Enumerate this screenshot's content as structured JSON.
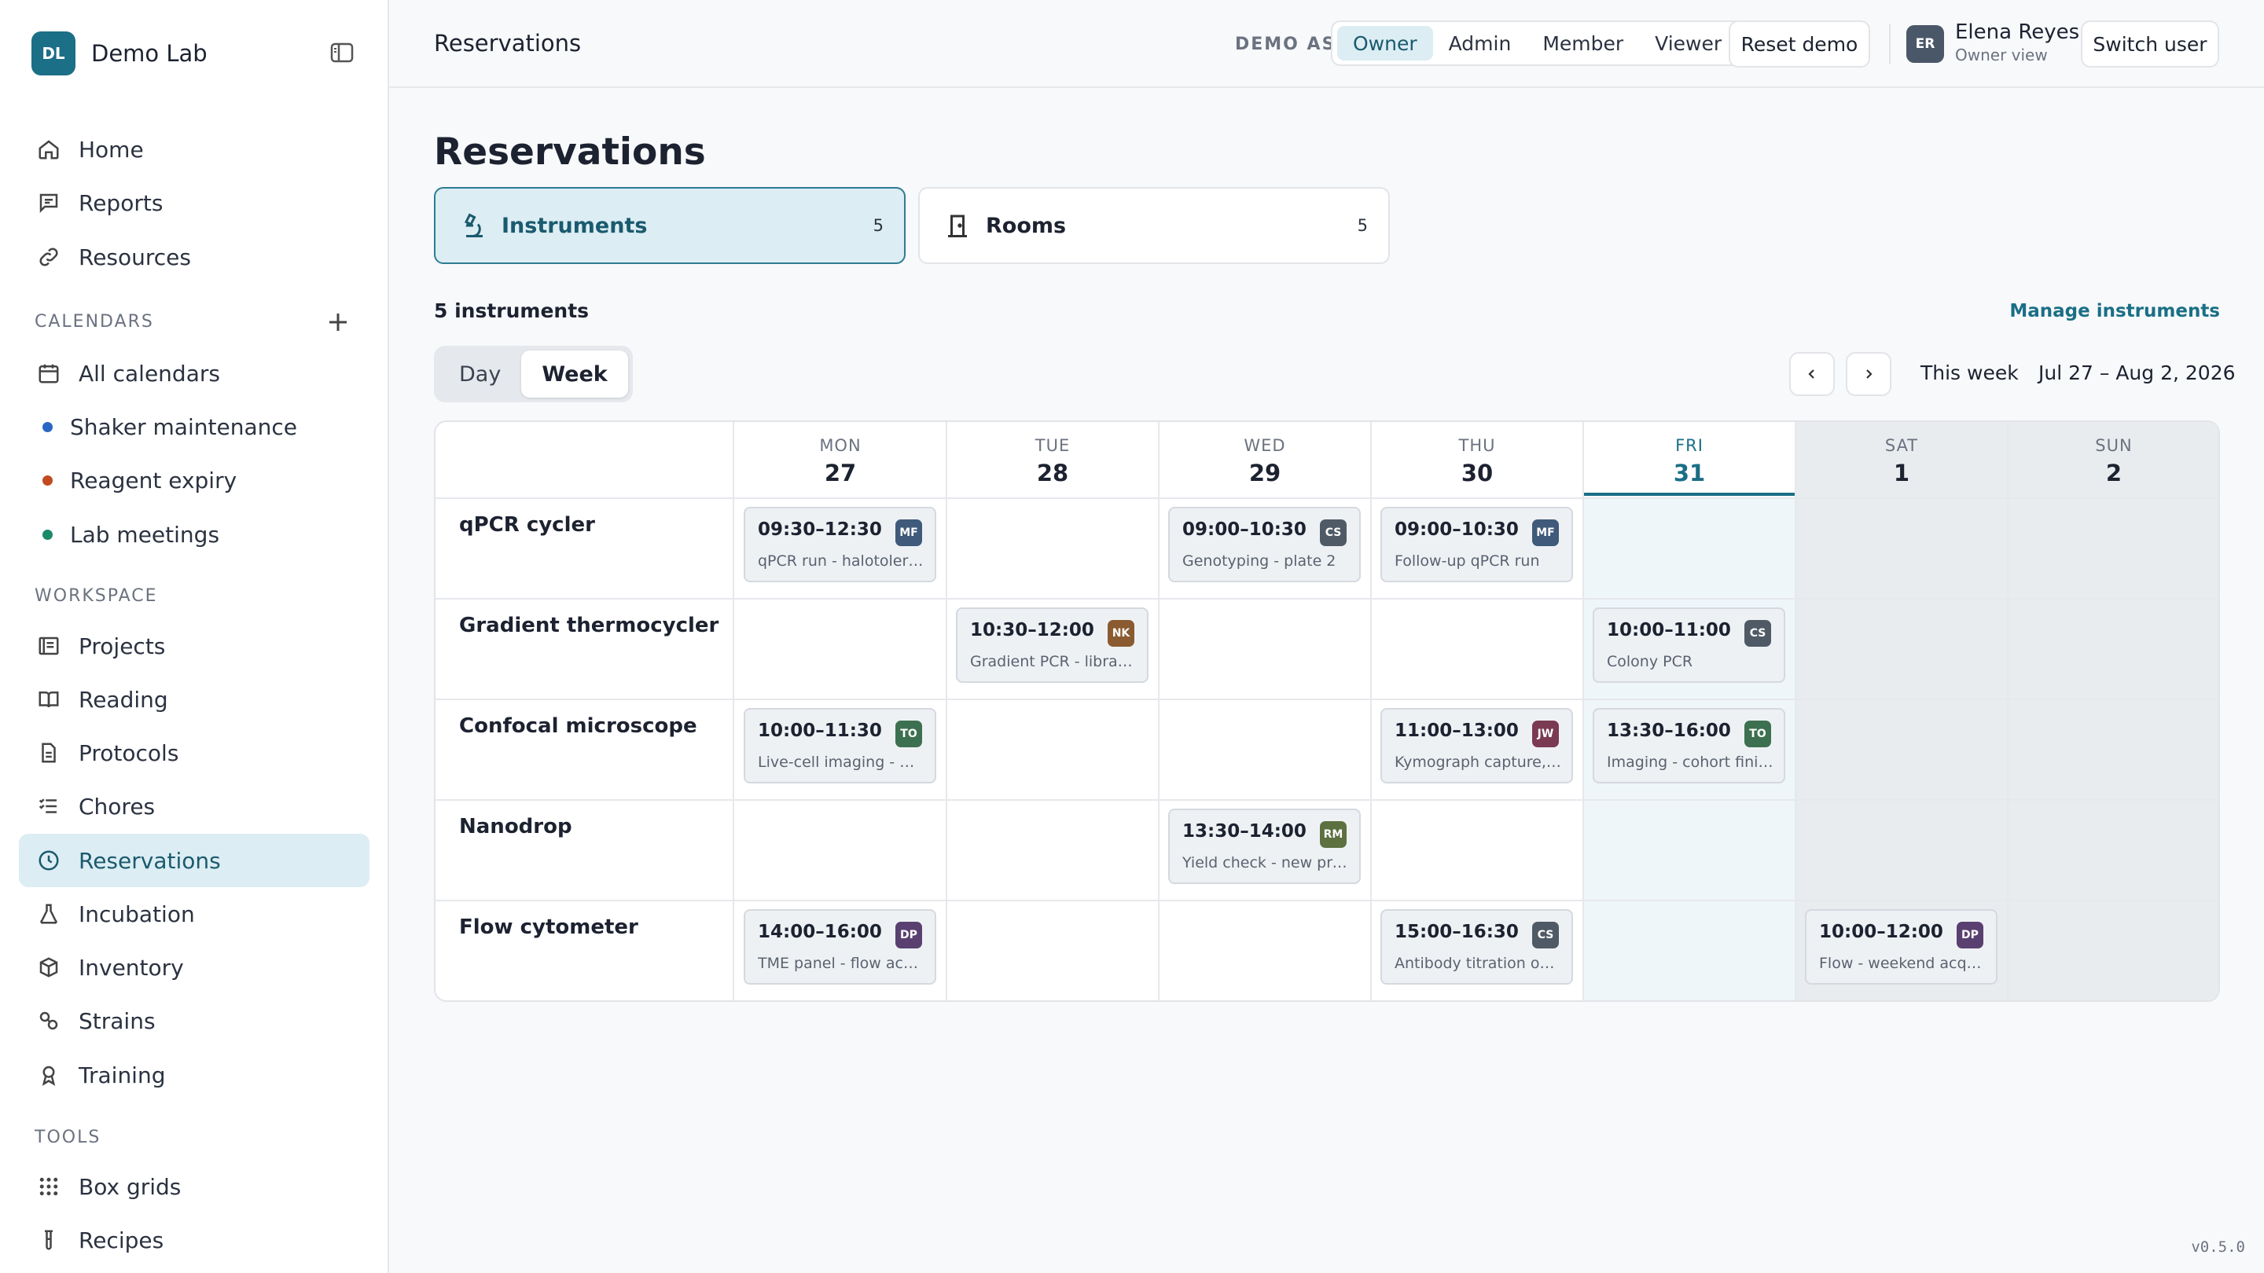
{
  "app": {
    "badge": "DL",
    "name": "Demo Lab"
  },
  "nav": {
    "top": [
      {
        "label": "Home",
        "icon": "home-icon"
      },
      {
        "label": "Reports",
        "icon": "message-square-icon"
      },
      {
        "label": "Resources",
        "icon": "link-icon"
      }
    ],
    "calendars_label": "CALENDARS",
    "calendars": [
      {
        "label": "All calendars",
        "icon": "calendar-icon"
      },
      {
        "label": "Shaker maintenance",
        "color": "#2a66c4"
      },
      {
        "label": "Reagent expiry",
        "color": "#c24a20"
      },
      {
        "label": "Lab meetings",
        "color": "#1a8a6a"
      }
    ],
    "workspace_label": "WORKSPACE",
    "workspace": [
      {
        "label": "Projects",
        "icon": "list-box-icon"
      },
      {
        "label": "Reading",
        "icon": "book-icon"
      },
      {
        "label": "Protocols",
        "icon": "document-icon"
      },
      {
        "label": "Chores",
        "icon": "checklist-icon"
      },
      {
        "label": "Reservations",
        "icon": "clock-icon",
        "active": true
      },
      {
        "label": "Incubation",
        "icon": "flask-icon"
      },
      {
        "label": "Inventory",
        "icon": "box-icon"
      },
      {
        "label": "Strains",
        "icon": "strains-icon"
      },
      {
        "label": "Training",
        "icon": "award-icon"
      }
    ],
    "tools_label": "TOOLS",
    "tools": [
      {
        "label": "Box grids",
        "icon": "grid-dots-icon"
      },
      {
        "label": "Recipes",
        "icon": "test-tube-icon"
      }
    ]
  },
  "header": {
    "title": "Reservations",
    "demo_as": "DEMO AS",
    "roles": [
      "Owner",
      "Admin",
      "Member",
      "Viewer"
    ],
    "active_role": "Owner",
    "reset": "Reset demo",
    "user": {
      "initials": "ER",
      "name": "Elena Reyes",
      "sub": "Owner view"
    },
    "switch": "Switch user"
  },
  "page": {
    "title": "Reservations",
    "types": [
      {
        "label": "Instruments",
        "count": "5",
        "active": true
      },
      {
        "label": "Rooms",
        "count": "5"
      }
    ],
    "count_label": "5 instruments",
    "manage": "Manage instruments",
    "views": [
      "Day",
      "Week"
    ],
    "active_view": "Week",
    "this_week": "This week",
    "range": "Jul 27 – Aug 2, 2026"
  },
  "calendar": {
    "days": [
      {
        "name": "MON",
        "num": "27"
      },
      {
        "name": "TUE",
        "num": "28"
      },
      {
        "name": "WED",
        "num": "29"
      },
      {
        "name": "THU",
        "num": "30"
      },
      {
        "name": "FRI",
        "num": "31",
        "today": true
      },
      {
        "name": "SAT",
        "num": "1",
        "weekend": true
      },
      {
        "name": "SUN",
        "num": "2",
        "weekend": true
      }
    ],
    "rows": [
      {
        "label": "qPCR cycler",
        "bookings": [
          {
            "day": 0,
            "time": "09:30–12:30",
            "desc": "qPCR run - halotolerance panel",
            "initials": "MF",
            "color": "#3f5a7a"
          },
          {
            "day": 2,
            "time": "09:00–10:30",
            "desc": "Genotyping - plate 2",
            "initials": "CS",
            "color": "#4f5a66"
          },
          {
            "day": 3,
            "time": "09:00–10:30",
            "desc": "Follow-up qPCR run",
            "initials": "MF",
            "color": "#3f5a7a"
          }
        ]
      },
      {
        "label": "Gradient thermocycler",
        "bookings": [
          {
            "day": 1,
            "time": "10:30–12:00",
            "desc": "Gradient PCR - library prep",
            "initials": "NK",
            "color": "#8a5a30"
          },
          {
            "day": 4,
            "time": "10:00–11:00",
            "desc": "Colony PCR",
            "initials": "CS",
            "color": "#4f5a66"
          }
        ]
      },
      {
        "label": "Confocal microscope",
        "bookings": [
          {
            "day": 0,
            "time": "10:00–11:30",
            "desc": "Live-cell imaging - mitosis",
            "initials": "TO",
            "color": "#3d7050"
          },
          {
            "day": 3,
            "time": "11:00–13:00",
            "desc": "Kymograph capture, series B",
            "initials": "JW",
            "color": "#7a3a52"
          },
          {
            "day": 4,
            "time": "13:30–16:00",
            "desc": "Imaging - cohort finish",
            "initials": "TO",
            "color": "#3d7050"
          }
        ]
      },
      {
        "label": "Nanodrop",
        "bookings": [
          {
            "day": 2,
            "time": "13:30–14:00",
            "desc": "Yield check - new preps",
            "initials": "RM",
            "color": "#5d7040"
          }
        ]
      },
      {
        "label": "Flow cytometer",
        "bookings": [
          {
            "day": 0,
            "time": "14:00–16:00",
            "desc": "TME panel - flow acquisition",
            "initials": "DP",
            "color": "#5a4070"
          },
          {
            "day": 3,
            "time": "15:00–16:30",
            "desc": "Antibody titration on beads",
            "initials": "CS",
            "color": "#4f5a66"
          },
          {
            "day": 5,
            "time": "10:00–12:00",
            "desc": "Flow - weekend acquisition",
            "initials": "DP",
            "color": "#5a4070"
          }
        ]
      }
    ]
  },
  "version": "v0.5.0"
}
